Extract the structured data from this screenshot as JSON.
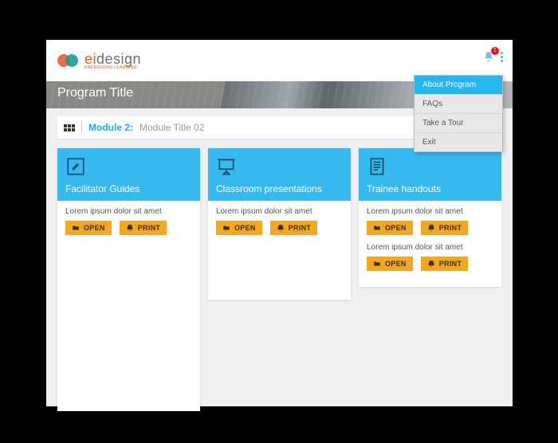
{
  "logo": {
    "brand_a": "ei",
    "brand_b": "design",
    "tagline": "ENERGISING LEARNING"
  },
  "notifications": {
    "count": "1"
  },
  "menu": {
    "items": [
      {
        "label": "About Program",
        "active": true
      },
      {
        "label": "FAQs",
        "active": false
      },
      {
        "label": "Take a Tour",
        "active": false
      },
      {
        "label": "Exit",
        "active": false
      }
    ]
  },
  "banner": {
    "title": "Program Title"
  },
  "breadcrumb": {
    "module": "Module 2:",
    "title": "Module Title 02"
  },
  "buttons": {
    "open": "OPEN",
    "print": "PRINT"
  },
  "cards": [
    {
      "title": "Facilitator Guides",
      "icon": "edit-square-icon",
      "items": [
        {
          "text": "Lorem ipsum dolor sit amet"
        }
      ],
      "tall": true
    },
    {
      "title": "Classroom presentations",
      "icon": "projector-icon",
      "items": [
        {
          "text": "Lorem ipsum dolor sit amet"
        }
      ],
      "tall": false
    },
    {
      "title": "Trainee handouts",
      "icon": "document-icon",
      "items": [
        {
          "text": "Lorem ipsum dolor sit amet"
        },
        {
          "text": "Lorem ipsum dolor sit amet"
        }
      ],
      "tall": false
    }
  ]
}
